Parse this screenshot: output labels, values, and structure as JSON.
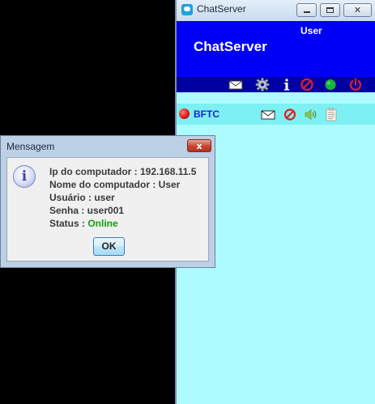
{
  "chat_window": {
    "title": "ChatServer",
    "close_glyph": "✕",
    "header": {
      "user": "User",
      "title": "ChatServer"
    },
    "toolbar_icons": [
      "mail-icon",
      "gear-icon",
      "info-icon",
      "block-icon",
      "online-status-icon",
      "power-icon"
    ],
    "contact": {
      "name": "BFTC",
      "status_color": "#e01010",
      "icons": [
        "mail-icon",
        "block-icon",
        "speaker-icon",
        "notes-icon"
      ]
    },
    "colors": {
      "header": "#0000f6",
      "toolbar": "#0000a2",
      "list_bg": "#aefbff",
      "contact_row": "#7df0f4"
    }
  },
  "dialog": {
    "title": "Mensagem",
    "close_glyph": "x",
    "icon": "info-icon",
    "lines": {
      "ip": "Ip do computador : 192.168.11.5",
      "name": "Nome do computador : User",
      "user": "Usuário : user",
      "pass": "Senha : user001",
      "status_label": "Status : ",
      "status_value": "Online"
    },
    "status_color": "#11a011",
    "ok_label": "OK"
  }
}
